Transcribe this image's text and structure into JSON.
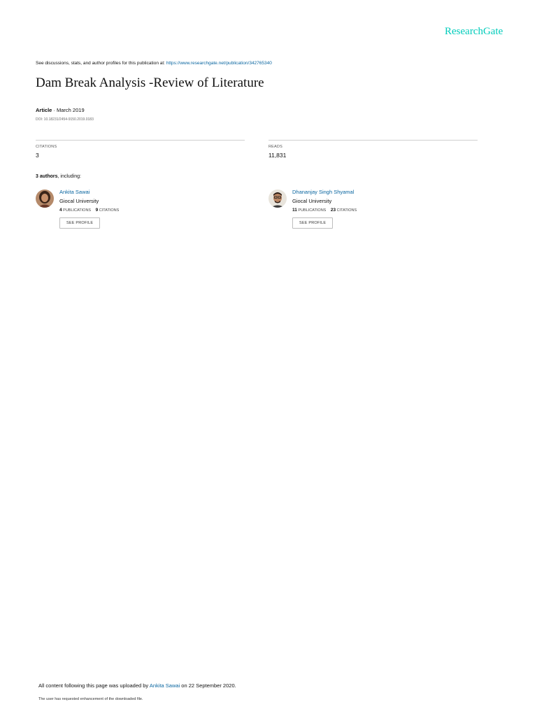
{
  "header": {
    "brand": "ResearchGate",
    "discussion_prefix": "See discussions, stats, and author profiles for this publication at:",
    "discussion_link": "https://www.researchgate.net/publication/342765340"
  },
  "publication": {
    "title": "Dam Break Analysis -Review of Literature",
    "type": "Article",
    "separator": " · ",
    "date": "March 2019",
    "doi": "DOI: 10.18231/2454-9150.2019.0183"
  },
  "stats": {
    "citations_label": "CITATIONS",
    "citations_value": "3",
    "reads_label": "READS",
    "reads_value": "11,831"
  },
  "authors": {
    "count_text": "3 authors",
    "including_text": ", including:",
    "list": [
      {
        "name": "Ankita Sawai",
        "institution": "Giocal University",
        "publications": "4",
        "publications_label": "PUBLICATIONS",
        "citations": "9",
        "citations_label": "CITATIONS",
        "button": "SEE PROFILE"
      },
      {
        "name": "Dhananjay Singh Shyamal",
        "institution": "Giocal University",
        "publications": "11",
        "publications_label": "PUBLICATIONS",
        "citations": "23",
        "citations_label": "CITATIONS",
        "button": "SEE PROFILE"
      }
    ]
  },
  "footer": {
    "upload_prefix": "All content following this page was uploaded by ",
    "uploader": "Ankita Sawai",
    "upload_suffix": " on 22 September 2020.",
    "note": "The user has requested enhancement of the downloaded file."
  },
  "colors": {
    "brand": "#00ccbb",
    "link": "#0a66a0"
  }
}
